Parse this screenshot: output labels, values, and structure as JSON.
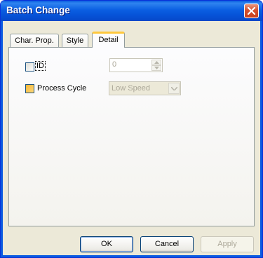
{
  "window": {
    "title": "Batch Change"
  },
  "tabs": [
    {
      "label": "Char. Prop.",
      "active": false
    },
    {
      "label": "Style",
      "active": false
    },
    {
      "label": "Detail",
      "active": true
    }
  ],
  "detail": {
    "id_label": "ID",
    "id_checked": false,
    "id_value": "0",
    "process_cycle_label": "Process Cycle",
    "process_cycle_checked": false,
    "process_cycle_value": "Low Speed"
  },
  "buttons": {
    "ok": "OK",
    "cancel": "Cancel",
    "apply": "Apply"
  },
  "colors": {
    "titlebar": "#0653d8",
    "close": "#d6512f",
    "active_tab_accent": "#ffc83c"
  }
}
